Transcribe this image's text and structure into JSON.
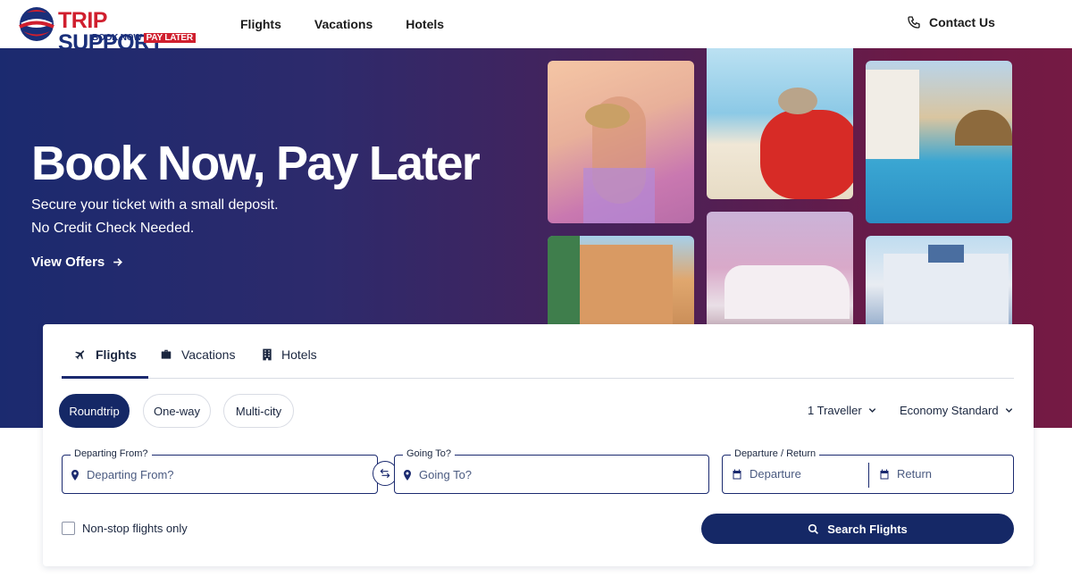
{
  "brand": {
    "title_part1": "TRIP",
    "title_part2": "SUPPORT",
    "tagline_part1": "BOOK NOW",
    "tagline_part2": "PAY LATER",
    "colors": {
      "red": "#d01f2e",
      "navy": "#1a2f7a"
    }
  },
  "nav": {
    "items": [
      {
        "label": "Flights"
      },
      {
        "label": "Vacations"
      },
      {
        "label": "Hotels"
      }
    ],
    "contact_label": "Contact Us",
    "contact_icon": "phone-icon"
  },
  "hero": {
    "title": "Book Now, Pay Later",
    "subtitle_line1": "Secure your ticket with a small deposit.",
    "subtitle_line2": "No Credit Check Needed.",
    "cta_label": "View Offers",
    "gradient_colors": [
      "#1b2a6f",
      "#4a2158",
      "#751a44"
    ]
  },
  "search": {
    "tabs": [
      {
        "label": "Flights",
        "icon": "plane-icon",
        "active": true
      },
      {
        "label": "Vacations",
        "icon": "suitcase-icon",
        "active": false
      },
      {
        "label": "Hotels",
        "icon": "building-icon",
        "active": false
      }
    ],
    "trip_types": [
      {
        "label": "Roundtrip",
        "active": true
      },
      {
        "label": "One-way",
        "active": false
      },
      {
        "label": "Multi-city",
        "active": false
      }
    ],
    "travellers": "1 Traveller",
    "cabin_class": "Economy Standard",
    "from": {
      "label": "Departing From?",
      "placeholder": "Departing From?"
    },
    "to": {
      "label": "Going To?",
      "placeholder": "Going To?"
    },
    "dates": {
      "label": "Departure / Return",
      "departure_placeholder": "Departure",
      "return_placeholder": "Return"
    },
    "nonstop_label": "Non-stop flights only",
    "nonstop_checked": false,
    "submit_label": "Search Flights",
    "accent_color": "#152866"
  }
}
